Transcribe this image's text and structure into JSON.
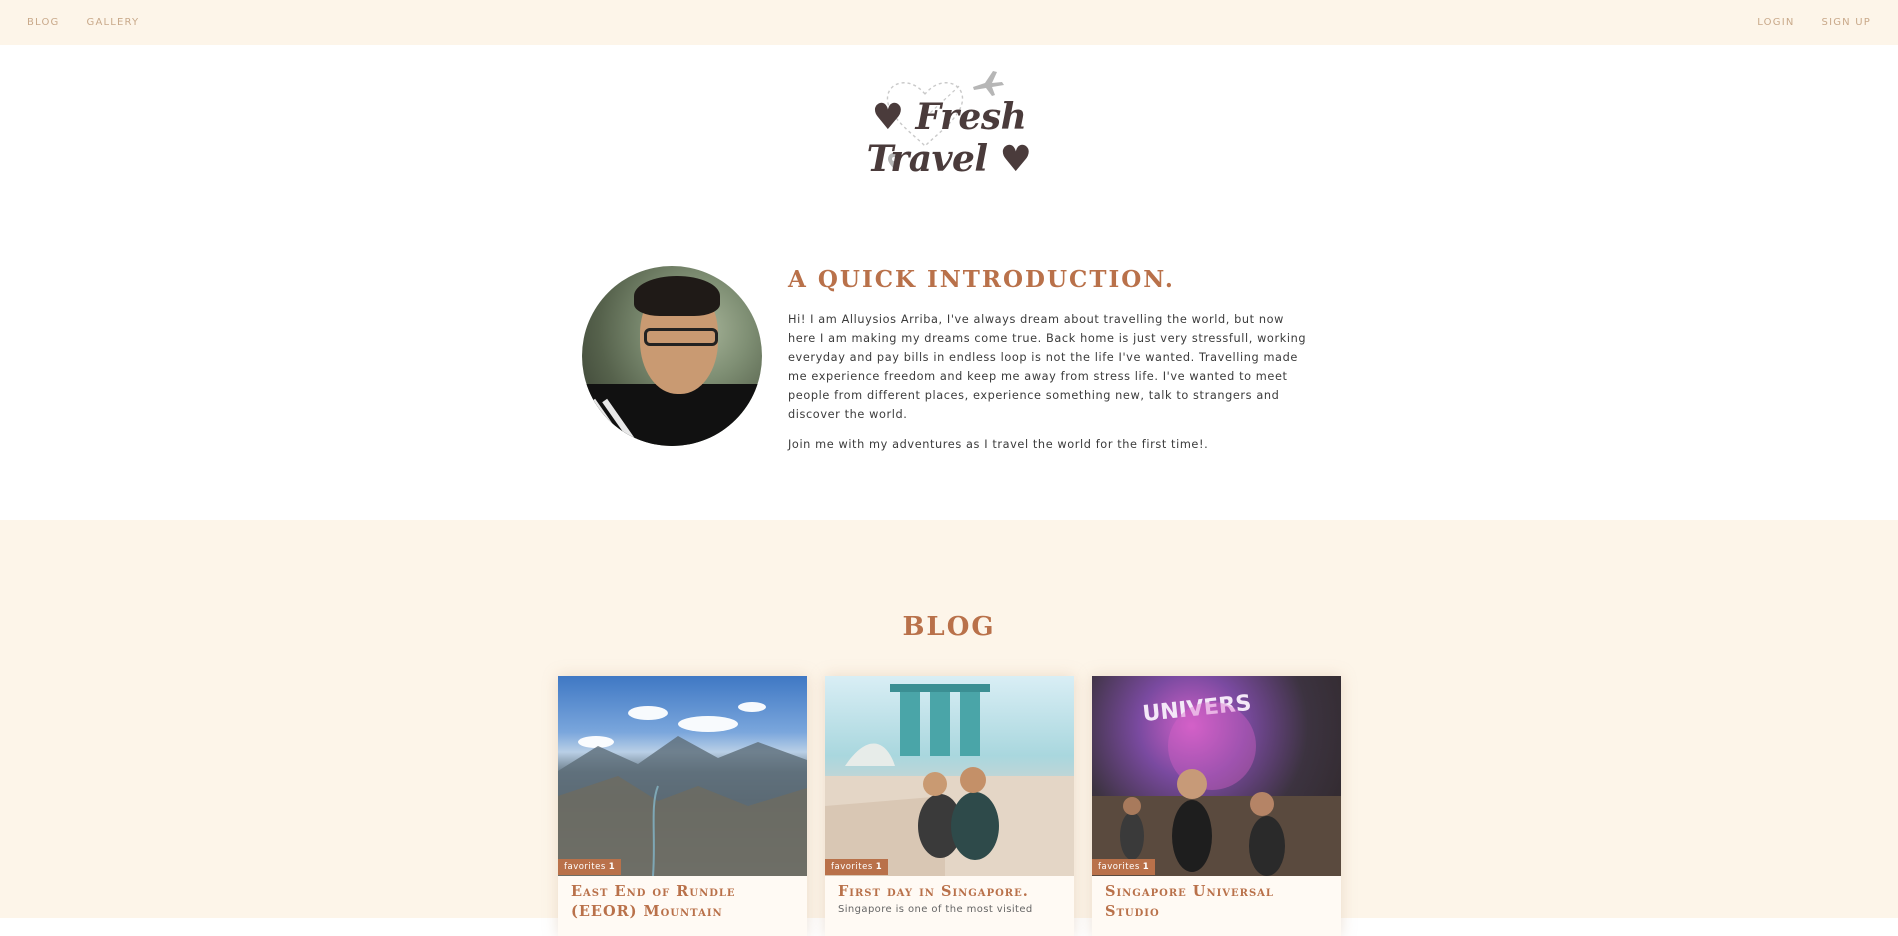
{
  "nav": {
    "left": [
      "BLOG",
      "GALLERY"
    ],
    "right": [
      "LOGIN",
      "SIGN UP"
    ]
  },
  "logo": {
    "text": "♥ Fresh Travel ♥",
    "icons": [
      "airplane-icon",
      "map-pin-icon",
      "heart-icon"
    ]
  },
  "intro": {
    "title": "A QUICK INTRODUCTION.",
    "paragraph1": "Hi! I am Alluysios Arriba, I've always dream about travelling the world, but now here I am making my dreams come true. Back home is just very stressfull, working everyday and pay bills in endless loop is not the life I've wanted. Travelling made me experience freedom and keep me away from stress life. I've wanted to meet people from different places, experience something new, talk to strangers and discover the world.",
    "paragraph2": "Join me with my adventures as I travel the world for the first time!."
  },
  "blog": {
    "title": "BLOG",
    "cards": [
      {
        "title": "East End of Rundle (EEOR) Mountain",
        "favorites_label": "favorites",
        "favorites_count": "1",
        "excerpt": ""
      },
      {
        "title": "First day in Singapore.",
        "favorites_label": "favorites",
        "favorites_count": "1",
        "excerpt": "Singapore is one of the most visited"
      },
      {
        "title": "Singapore Universal Studio",
        "favorites_label": "favorites",
        "favorites_count": "1",
        "excerpt": ""
      }
    ]
  },
  "colors": {
    "accent": "#b9714a",
    "cream": "#fdf5e9",
    "nav_text": "#c9a98a",
    "logo_text": "#4a3b3b"
  }
}
